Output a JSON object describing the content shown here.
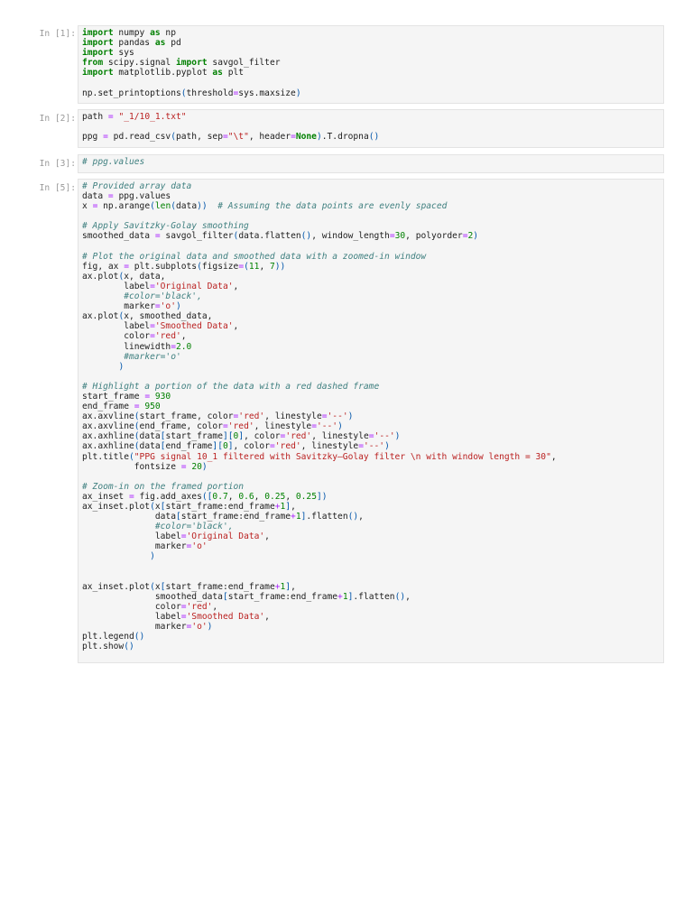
{
  "cells": [
    {
      "prompt": "In [1]:",
      "lines": [
        [
          [
            "kw",
            "import"
          ],
          [
            "t",
            " numpy "
          ],
          [
            "kw",
            "as"
          ],
          [
            "t",
            " np"
          ]
        ],
        [
          [
            "kw",
            "import"
          ],
          [
            "t",
            " pandas "
          ],
          [
            "kw",
            "as"
          ],
          [
            "t",
            " pd"
          ]
        ],
        [
          [
            "kw",
            "import"
          ],
          [
            "t",
            " sys"
          ]
        ],
        [
          [
            "kw",
            "from"
          ],
          [
            "t",
            " scipy.signal "
          ],
          [
            "kw",
            "import"
          ],
          [
            "t",
            " savgol_filter"
          ]
        ],
        [
          [
            "kw",
            "import"
          ],
          [
            "t",
            " matplotlib.pyplot "
          ],
          [
            "kw",
            "as"
          ],
          [
            "t",
            " plt"
          ]
        ],
        [],
        [
          [
            "t",
            "np.set_printoptions"
          ],
          [
            "p",
            "("
          ],
          [
            "t",
            "threshold"
          ],
          [
            "op",
            "="
          ],
          [
            "t",
            "sys.maxsize"
          ],
          [
            "p",
            ")"
          ]
        ]
      ]
    },
    {
      "prompt": "In [2]:",
      "lines": [
        [
          [
            "t",
            "path "
          ],
          [
            "op",
            "="
          ],
          [
            "t",
            " "
          ],
          [
            "str",
            "\"_1/10_1.txt\""
          ]
        ],
        [],
        [
          [
            "t",
            "ppg "
          ],
          [
            "op",
            "="
          ],
          [
            "t",
            " pd.read_csv"
          ],
          [
            "p",
            "("
          ],
          [
            "t",
            "path, sep"
          ],
          [
            "op",
            "="
          ],
          [
            "str",
            "\"\\t\""
          ],
          [
            "t",
            ", header"
          ],
          [
            "op",
            "="
          ],
          [
            "kw",
            "None"
          ],
          [
            "p",
            ")"
          ],
          [
            "t",
            ".T.dropna"
          ],
          [
            "p",
            "()"
          ]
        ]
      ]
    },
    {
      "prompt": "In [3]:",
      "lines": [
        [
          [
            "cm",
            "# ppg.values"
          ]
        ]
      ]
    },
    {
      "prompt": "In [5]:",
      "lines": [
        [
          [
            "cm",
            "# Provided array data"
          ]
        ],
        [
          [
            "t",
            "data "
          ],
          [
            "op",
            "="
          ],
          [
            "t",
            " ppg.values"
          ]
        ],
        [
          [
            "t",
            "x "
          ],
          [
            "op",
            "="
          ],
          [
            "t",
            " np.arange"
          ],
          [
            "p",
            "("
          ],
          [
            "bi",
            "len"
          ],
          [
            "p",
            "("
          ],
          [
            "t",
            "data"
          ],
          [
            "p",
            "))"
          ],
          [
            "t",
            "  "
          ],
          [
            "cm",
            "# Assuming the data points are evenly spaced"
          ]
        ],
        [],
        [
          [
            "cm",
            "# Apply Savitzky-Golay smoothing"
          ]
        ],
        [
          [
            "t",
            "smoothed_data "
          ],
          [
            "op",
            "="
          ],
          [
            "t",
            " savgol_filter"
          ],
          [
            "p",
            "("
          ],
          [
            "t",
            "data.flatten"
          ],
          [
            "p",
            "()"
          ],
          [
            "t",
            ", window_length"
          ],
          [
            "op",
            "="
          ],
          [
            "num",
            "30"
          ],
          [
            "t",
            ", polyorder"
          ],
          [
            "op",
            "="
          ],
          [
            "num",
            "2"
          ],
          [
            "p",
            ")"
          ]
        ],
        [],
        [
          [
            "cm",
            "# Plot the original data and smoothed data with a zoomed-in window"
          ]
        ],
        [
          [
            "t",
            "fig, ax "
          ],
          [
            "op",
            "="
          ],
          [
            "t",
            " plt.subplots"
          ],
          [
            "p",
            "("
          ],
          [
            "t",
            "figsize"
          ],
          [
            "op",
            "="
          ],
          [
            "p",
            "("
          ],
          [
            "num",
            "11"
          ],
          [
            "t",
            ", "
          ],
          [
            "num",
            "7"
          ],
          [
            "p",
            "))"
          ]
        ],
        [
          [
            "t",
            "ax.plot"
          ],
          [
            "p",
            "("
          ],
          [
            "t",
            "x, data,"
          ]
        ],
        [
          [
            "t",
            "        label"
          ],
          [
            "op",
            "="
          ],
          [
            "str",
            "'Original Data'"
          ],
          [
            "t",
            ","
          ]
        ],
        [
          [
            "t",
            "        "
          ],
          [
            "cm",
            "#color='black',"
          ]
        ],
        [
          [
            "t",
            "        marker"
          ],
          [
            "op",
            "="
          ],
          [
            "str",
            "'o'"
          ],
          [
            "p",
            ")"
          ]
        ],
        [
          [
            "t",
            "ax.plot"
          ],
          [
            "p",
            "("
          ],
          [
            "t",
            "x, smoothed_data,"
          ]
        ],
        [
          [
            "t",
            "        label"
          ],
          [
            "op",
            "="
          ],
          [
            "str",
            "'Smoothed Data'"
          ],
          [
            "t",
            ","
          ]
        ],
        [
          [
            "t",
            "        color"
          ],
          [
            "op",
            "="
          ],
          [
            "str",
            "'red'"
          ],
          [
            "t",
            ","
          ]
        ],
        [
          [
            "t",
            "        linewidth"
          ],
          [
            "op",
            "="
          ],
          [
            "num",
            "2.0"
          ]
        ],
        [
          [
            "t",
            "        "
          ],
          [
            "cm",
            "#marker='o'"
          ]
        ],
        [
          [
            "t",
            "       "
          ],
          [
            "p",
            ")"
          ]
        ],
        [],
        [
          [
            "cm",
            "# Highlight a portion of the data with a red dashed frame"
          ]
        ],
        [
          [
            "t",
            "start_frame "
          ],
          [
            "op",
            "="
          ],
          [
            "t",
            " "
          ],
          [
            "num",
            "930"
          ]
        ],
        [
          [
            "t",
            "end_frame "
          ],
          [
            "op",
            "="
          ],
          [
            "t",
            " "
          ],
          [
            "num",
            "950"
          ]
        ],
        [
          [
            "t",
            "ax.axvline"
          ],
          [
            "p",
            "("
          ],
          [
            "t",
            "start_frame, color"
          ],
          [
            "op",
            "="
          ],
          [
            "str",
            "'red'"
          ],
          [
            "t",
            ", linestyle"
          ],
          [
            "op",
            "="
          ],
          [
            "str",
            "'--'"
          ],
          [
            "p",
            ")"
          ]
        ],
        [
          [
            "t",
            "ax.axvline"
          ],
          [
            "p",
            "("
          ],
          [
            "t",
            "end_frame, color"
          ],
          [
            "op",
            "="
          ],
          [
            "str",
            "'red'"
          ],
          [
            "t",
            ", linestyle"
          ],
          [
            "op",
            "="
          ],
          [
            "str",
            "'--'"
          ],
          [
            "p",
            ")"
          ]
        ],
        [
          [
            "t",
            "ax.axhline"
          ],
          [
            "p",
            "("
          ],
          [
            "t",
            "data"
          ],
          [
            "p",
            "["
          ],
          [
            "t",
            "start_frame"
          ],
          [
            "p",
            "]["
          ],
          [
            "num",
            "0"
          ],
          [
            "p",
            "]"
          ],
          [
            "t",
            ", color"
          ],
          [
            "op",
            "="
          ],
          [
            "str",
            "'red'"
          ],
          [
            "t",
            ", linestyle"
          ],
          [
            "op",
            "="
          ],
          [
            "str",
            "'--'"
          ],
          [
            "p",
            ")"
          ]
        ],
        [
          [
            "t",
            "ax.axhline"
          ],
          [
            "p",
            "("
          ],
          [
            "t",
            "data"
          ],
          [
            "p",
            "["
          ],
          [
            "t",
            "end_frame"
          ],
          [
            "p",
            "]["
          ],
          [
            "num",
            "0"
          ],
          [
            "p",
            "]"
          ],
          [
            "t",
            ", color"
          ],
          [
            "op",
            "="
          ],
          [
            "str",
            "'red'"
          ],
          [
            "t",
            ", linestyle"
          ],
          [
            "op",
            "="
          ],
          [
            "str",
            "'--'"
          ],
          [
            "p",
            ")"
          ]
        ],
        [
          [
            "t",
            "plt.title"
          ],
          [
            "p",
            "("
          ],
          [
            "str",
            "\"PPG signal 10_1 filtered with Savitzky–Golay filter \\n with window length = 30\""
          ],
          [
            "t",
            ","
          ]
        ],
        [
          [
            "t",
            "          fontsize "
          ],
          [
            "op",
            "="
          ],
          [
            "t",
            " "
          ],
          [
            "num",
            "20"
          ],
          [
            "p",
            ")"
          ]
        ],
        [],
        [
          [
            "cm",
            "# Zoom-in on the framed portion"
          ]
        ],
        [
          [
            "t",
            "ax_inset "
          ],
          [
            "op",
            "="
          ],
          [
            "t",
            " fig.add_axes"
          ],
          [
            "p",
            "(["
          ],
          [
            "num",
            "0.7"
          ],
          [
            "t",
            ", "
          ],
          [
            "num",
            "0.6"
          ],
          [
            "t",
            ", "
          ],
          [
            "num",
            "0.25"
          ],
          [
            "t",
            ", "
          ],
          [
            "num",
            "0.25"
          ],
          [
            "p",
            "])"
          ]
        ],
        [
          [
            "t",
            "ax_inset.plot"
          ],
          [
            "p",
            "("
          ],
          [
            "t",
            "x"
          ],
          [
            "p",
            "["
          ],
          [
            "t",
            "start_frame:end_frame"
          ],
          [
            "op",
            "+"
          ],
          [
            "num",
            "1"
          ],
          [
            "p",
            "]"
          ],
          [
            "t",
            ","
          ]
        ],
        [
          [
            "t",
            "              data"
          ],
          [
            "p",
            "["
          ],
          [
            "t",
            "start_frame:end_frame"
          ],
          [
            "op",
            "+"
          ],
          [
            "num",
            "1"
          ],
          [
            "p",
            "]"
          ],
          [
            "t",
            ".flatten"
          ],
          [
            "p",
            "()"
          ],
          [
            "t",
            ","
          ]
        ],
        [
          [
            "t",
            "              "
          ],
          [
            "cm",
            "#color='black',"
          ]
        ],
        [
          [
            "t",
            "              label"
          ],
          [
            "op",
            "="
          ],
          [
            "str",
            "'Original Data'"
          ],
          [
            "t",
            ","
          ]
        ],
        [
          [
            "t",
            "              marker"
          ],
          [
            "op",
            "="
          ],
          [
            "str",
            "'o'"
          ]
        ],
        [
          [
            "t",
            "             "
          ],
          [
            "p",
            ")"
          ]
        ],
        [],
        [],
        [
          [
            "t",
            "ax_inset.plot"
          ],
          [
            "p",
            "("
          ],
          [
            "t",
            "x"
          ],
          [
            "p",
            "["
          ],
          [
            "t",
            "start_frame:end_frame"
          ],
          [
            "op",
            "+"
          ],
          [
            "num",
            "1"
          ],
          [
            "p",
            "]"
          ],
          [
            "t",
            ","
          ]
        ],
        [
          [
            "t",
            "              smoothed_data"
          ],
          [
            "p",
            "["
          ],
          [
            "t",
            "start_frame:end_frame"
          ],
          [
            "op",
            "+"
          ],
          [
            "num",
            "1"
          ],
          [
            "p",
            "]"
          ],
          [
            "t",
            ".flatten"
          ],
          [
            "p",
            "()"
          ],
          [
            "t",
            ","
          ]
        ],
        [
          [
            "t",
            "              color"
          ],
          [
            "op",
            "="
          ],
          [
            "str",
            "'red'"
          ],
          [
            "t",
            ","
          ]
        ],
        [
          [
            "t",
            "              label"
          ],
          [
            "op",
            "="
          ],
          [
            "str",
            "'Smoothed Data'"
          ],
          [
            "t",
            ","
          ]
        ],
        [
          [
            "t",
            "              marker"
          ],
          [
            "op",
            "="
          ],
          [
            "str",
            "'o'"
          ],
          [
            "p",
            ")"
          ]
        ],
        [
          [
            "t",
            "plt.legend"
          ],
          [
            "p",
            "()"
          ]
        ],
        [
          [
            "t",
            "plt.show"
          ],
          [
            "p",
            "()"
          ]
        ]
      ]
    }
  ]
}
